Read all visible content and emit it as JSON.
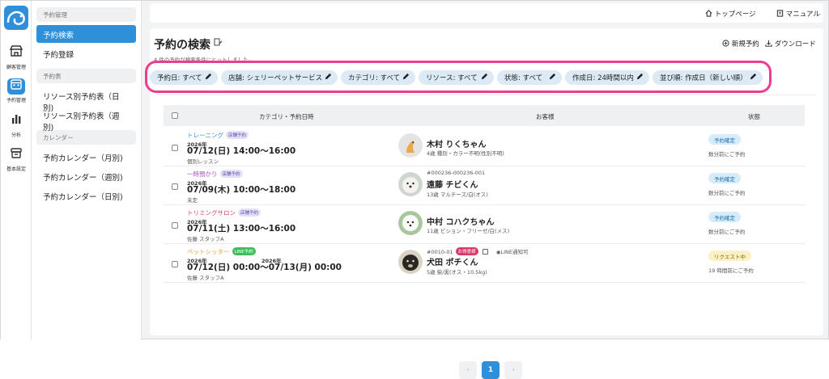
{
  "colors": {
    "accent": "#2f8fd8",
    "highlight": "#ee3d8f",
    "chip_bg": "#dceaf6"
  },
  "rail": [
    {
      "label": "顧客管理",
      "icon": "store-icon"
    },
    {
      "label": "予約管理",
      "icon": "calendar-icon",
      "active": true
    },
    {
      "label": "分析",
      "icon": "bar-chart-icon"
    },
    {
      "label": "基本設定",
      "icon": "archive-icon"
    }
  ],
  "sidebar": {
    "sections": [
      {
        "title": "予約管理",
        "items": [
          {
            "label": "予約検索",
            "active": true
          },
          {
            "label": "予約登録"
          }
        ]
      },
      {
        "title": "予約表",
        "items": [
          {
            "label": "リソース別予約表（日別)"
          },
          {
            "label": "リソース別予約表（週別)"
          }
        ]
      },
      {
        "title": "カレンダー",
        "items": [
          {
            "label": "予約カレンダー（月別)"
          },
          {
            "label": "予約カレンダー（週別)"
          },
          {
            "label": "予約カレンダー（日別)"
          }
        ]
      }
    ]
  },
  "topbar": {
    "top_page": "トップページ",
    "manual": "マニュアル"
  },
  "page": {
    "title": "予約の検索",
    "subtitle": "4 件の予約が検索条件にヒットしました。",
    "new_reservation": "新規予約",
    "download": "ダウンロード"
  },
  "filters": [
    "予約日: すべて",
    "店舗: シェリーペットサービス",
    "カテゴリ: すべて",
    "リソース: すべて",
    "状態: すべて",
    "作成日: 24時間以内",
    "並び順: 作成日（新しい順）"
  ],
  "table": {
    "headers": {
      "category_datetime": "カテゴリ・予約日時",
      "customer": "お客様",
      "status": "状態"
    },
    "rows": [
      {
        "category": "トレーニング",
        "category_color": "#2f8fd8",
        "badge": "店舗予約",
        "badge_bg": "#e4e1f7",
        "badge_color": "#5a4fb0",
        "year": "2026年",
        "datetime": "07/12(日) 14:00〜16:00",
        "sub": "個別レッスン",
        "customer_id": "",
        "customer_tag": "",
        "customer_name": "木村 りくちゃん",
        "customer_info": "4歳 種別・カラー不明(性別不明)",
        "status": "予約確定",
        "status_bg": "#d7ecfa",
        "status_color": "#1d6fb0",
        "ago": "数分前にご予約"
      },
      {
        "category": "一時預かり",
        "category_color": "#b04fc8",
        "badge": "店舗予約",
        "badge_bg": "#e4e1f7",
        "badge_color": "#5a4fb0",
        "year": "2026年",
        "datetime": "07/09(木) 10:00〜18:00",
        "sub": "未定",
        "customer_id": "#000236-000236-001",
        "customer_tag": "",
        "customer_name": "遠藤 チビくん",
        "customer_info": "13歳 マルチーズ/白(オス)",
        "status": "予約確定",
        "status_bg": "#d7ecfa",
        "status_color": "#1d6fb0",
        "ago": "数分前にご予約"
      },
      {
        "category": "トリミングサロン",
        "category_color": "#d9455a",
        "badge": "店舗予約",
        "badge_bg": "#e4e1f7",
        "badge_color": "#5a4fb0",
        "year": "2026年",
        "datetime": "07/11(土) 13:00〜16:00",
        "sub": "佐藤 スタッフA",
        "customer_id": "",
        "customer_tag": "",
        "customer_name": "中村 コハクちゃん",
        "customer_info": "11歳 ビション・フリーゼ/白(メス)",
        "status": "予約確定",
        "status_bg": "#d7ecfa",
        "status_color": "#1d6fb0",
        "ago": "数分前にご予約"
      },
      {
        "category": "ペットシッター",
        "category_color": "#e8a23a",
        "badge": "LINE予約",
        "badge_bg": "#3ebd5a",
        "badge_color": "#ffffff",
        "year": "2026年",
        "year2": "2026年",
        "datetime": "07/12(日) 00:00〜07/13(月) 00:00",
        "sub": "佐藤 スタッフA",
        "customer_id": "#0010-01",
        "customer_tag": "お得意様",
        "line_notice": "LINE通知可",
        "customer_name": "犬田 ポチくん",
        "customer_info": "5歳 柴/黒(オス・10.5kg)",
        "status": "リクエスト中",
        "status_bg": "#fbf1c4",
        "status_color": "#8a6a00",
        "ago": "19 時間前にご予約"
      }
    ]
  },
  "pagination": {
    "current": "1"
  }
}
